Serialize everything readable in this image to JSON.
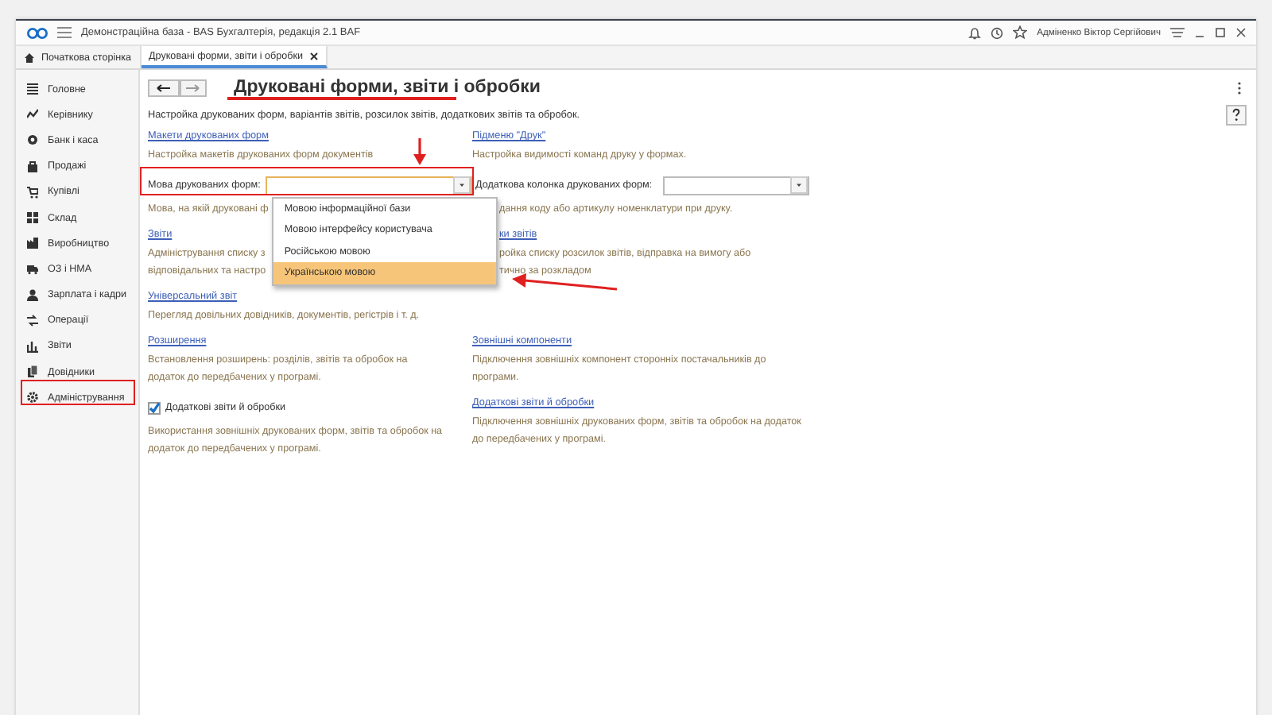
{
  "window": {
    "title": "Демонстраційна база - BAS Бухгалтерія, редакція 2.1 BAF",
    "user": "Адміненко Віктор Сергійович"
  },
  "tabs": [
    {
      "label": "Початкова сторінка",
      "selected": false,
      "kind": "home"
    },
    {
      "label": "Друковані форми, звіти і обробки",
      "selected": true,
      "kind": "page"
    }
  ],
  "sidebar": {
    "items": [
      {
        "label": "Головне"
      },
      {
        "label": "Керівнику"
      },
      {
        "label": "Банк і каса"
      },
      {
        "label": "Продажі"
      },
      {
        "label": "Купівлі"
      },
      {
        "label": "Склад"
      },
      {
        "label": "Виробництво"
      },
      {
        "label": "ОЗ і НМА"
      },
      {
        "label": "Зарплата і кадри"
      },
      {
        "label": "Операції"
      },
      {
        "label": "Звіти"
      },
      {
        "label": "Довідники"
      },
      {
        "label": "Адміністрування"
      }
    ]
  },
  "page": {
    "title": "Друковані форми, звіти і обробки",
    "description": "Настройка друкованих форм, варіантів звітів, розсилок звітів, додаткових звітів та обробок.",
    "rows": [
      {
        "left": {
          "kind": "link",
          "text": "Макети друкованих форм",
          "description": "Настройка макетів друкованих форм документів"
        },
        "right": {
          "kind": "link",
          "text": "Підменю \"Друк\"",
          "description": "Настройка видимості команд друку у формах."
        }
      },
      {
        "left": {
          "kind": "field",
          "label": "Мова друкованих форм:",
          "description": "Мова, на якій друковані ф",
          "dropdown": [
            {
              "label": "Мовою інформаційної бази",
              "selected": false
            },
            {
              "label": "Мовою інтерфейсу користувача",
              "selected": false
            },
            {
              "label": "Російською мовою",
              "selected": false
            },
            {
              "label": "Українською мовою",
              "selected": true
            }
          ]
        },
        "right": {
          "kind": "field",
          "label": "Додаткова колонка друкованих форм:",
          "description": "дання коду або артикулу номенклатури при друку.",
          "covered": true
        }
      },
      {
        "left": {
          "kind": "link",
          "text": "Звіти",
          "description": "Адміністрування списку з\nвідповідальних та настро"
        },
        "right": {
          "kind": "link",
          "text": "ки звітів",
          "description": "ройка списку розсилок звітів, відправка на вимогу або\nтично за розкладом",
          "covered": true
        }
      },
      {
        "left": {
          "kind": "link",
          "text": "Універсальний звіт",
          "description": "Перегляд довільних довідників, документів, регістрів і т. д."
        }
      },
      {
        "left": {
          "kind": "link",
          "text": "Розширення",
          "description": "Встановлення розширень: розділів, звітів та обробок на\nдодаток до передбачених у програмі."
        },
        "right": {
          "kind": "link",
          "text": "Зовнішні компоненти",
          "description": "Підключення зовнішніх компонент сторонніх постачальників до\nпрограми."
        }
      },
      {
        "left": {
          "kind": "checkbox",
          "label": "Додаткові звіти й обробки",
          "checked": true,
          "description": "Використання зовнішніх друкованих форм, звітів та обробок на\nдодаток до передбачених у програмі."
        },
        "right": {
          "kind": "link",
          "text": "Додаткові звіти й обробки",
          "description": "Підключення зовнішніх друкованих форм, звітів та обробок на додаток\nдо передбачених у програмі."
        }
      }
    ]
  }
}
